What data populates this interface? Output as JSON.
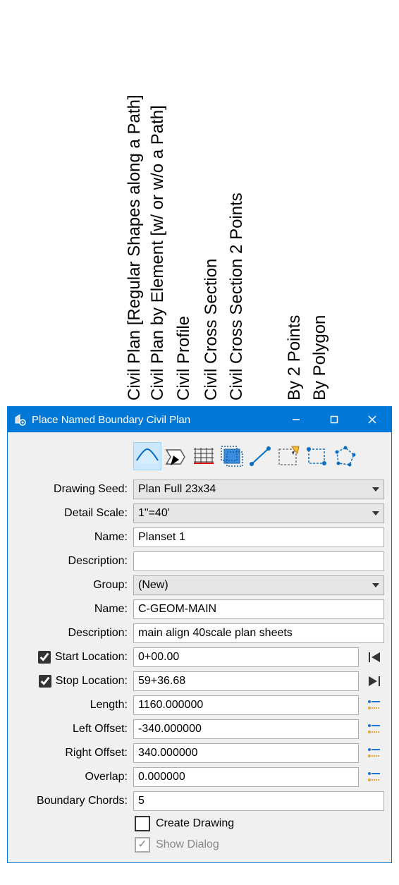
{
  "vertical_labels": {
    "l1": "Civil Plan [Regular Shapes along a Path]",
    "l2": "Civil Plan by Element [w/ or w/o a Path]",
    "l3": "Civil Profile",
    "l4": "Civil Cross Section",
    "l5": "Civil Cross Section 2 Points",
    "l6": "By 2 Points",
    "l7": "By Polygon"
  },
  "dialog": {
    "title": "Place Named Boundary Civil Plan",
    "labels": {
      "drawing_seed": "Drawing Seed:",
      "detail_scale": "Detail Scale:",
      "name": "Name:",
      "description": "Description:",
      "group": "Group:",
      "name2": "Name:",
      "description2": "Description:",
      "start_location": "Start Location:",
      "stop_location": "Stop Location:",
      "length": "Length:",
      "left_offset": "Left Offset:",
      "right_offset": "Right Offset:",
      "overlap": "Overlap:",
      "boundary_chords": "Boundary Chords:",
      "create_drawing": "Create Drawing",
      "show_dialog": "Show Dialog"
    },
    "values": {
      "drawing_seed": "Plan Full 23x34",
      "detail_scale": "1\"=40'",
      "name": "Planset 1",
      "description": "",
      "group": "(New)",
      "name2": "C-GEOM-MAIN",
      "description2": "main align 40scale plan sheets",
      "start_location": "0+00.00",
      "stop_location": "59+36.68",
      "length": "1160.000000",
      "left_offset": "-340.000000",
      "right_offset": "340.000000",
      "overlap": "0.000000",
      "boundary_chords": "5"
    },
    "checks": {
      "start_location": true,
      "stop_location": true,
      "create_drawing": false,
      "show_dialog": true
    }
  }
}
